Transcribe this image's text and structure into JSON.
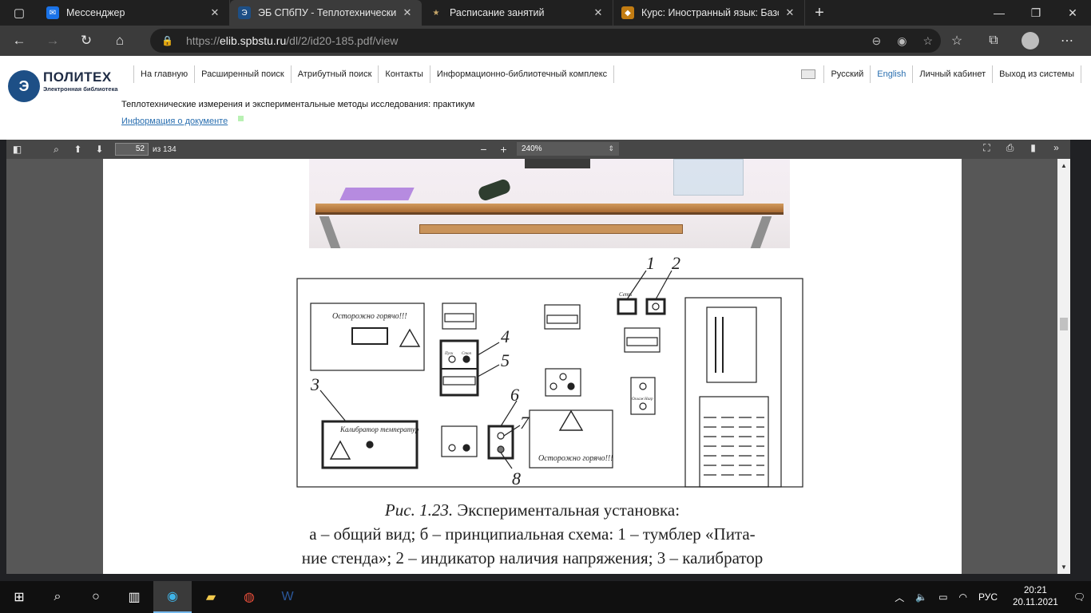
{
  "browser": {
    "tabs": [
      {
        "title": "Мессенджер",
        "fav_color": "#1a73e8",
        "fav_glyph": "✉",
        "active": false
      },
      {
        "title": "ЭБ СПбПУ - Теплотехнические",
        "fav_color": "#1d4f86",
        "fav_glyph": "Э",
        "active": true
      },
      {
        "title": "Расписание занятий",
        "fav_color": "#7a6a4a",
        "fav_glyph": "★",
        "active": false
      },
      {
        "title": "Курс: Иностранный язык: Базов",
        "fav_color": "#c27c12",
        "fav_glyph": "◆",
        "active": false
      }
    ],
    "close_glyph": "✕",
    "new_tab_glyph": "+",
    "url_prefix": "https://",
    "url_host": "elib.spbstu.ru",
    "url_path": "/dl/2/id20-185.pdf/view"
  },
  "site": {
    "logo_name": "ПОЛИТЕХ",
    "logo_sub": "Электронная библиотека",
    "menu": [
      "На главную",
      "Расширенный поиск",
      "Атрибутный поиск",
      "Контакты",
      "Информационно-библиотечный комплекс"
    ],
    "lang_ru": "Русский",
    "lang_en": "English",
    "account": "Личный кабинет",
    "logout": "Выход из системы",
    "doc_title": "Теплотехнические измерения и экспериментальные методы исследования: практикум",
    "doc_info": "Информация о документе"
  },
  "pdf": {
    "page": "52",
    "page_total": "из 134",
    "zoom": "240%"
  },
  "figure": {
    "labels": [
      "1",
      "2",
      "3",
      "4",
      "5",
      "6",
      "7",
      "8"
    ],
    "set_label": "Сеть",
    "warning_1": "Осторожно горячо!!!",
    "warning_2": "Осторожно горячо!!!",
    "calibrator": "Калибратор температур",
    "pair_small": [
      "Пуск",
      "Стоп"
    ],
    "cooling": [
      "Охлаж",
      "Нагр"
    ],
    "caption_line1_italic": "Рис. 1.23.",
    "caption_line1_rest": " Экспериментальная установка:",
    "caption_line2": "а – общий вид; б – принципиальная схема: 1 – тумблер «Пита-",
    "caption_line3": "ние стенда»; 2 – индикатор наличия напряжения; 3 – калибратор"
  },
  "taskbar": {
    "lang": "РУС",
    "time": "20:21",
    "date": "20.11.2021"
  }
}
